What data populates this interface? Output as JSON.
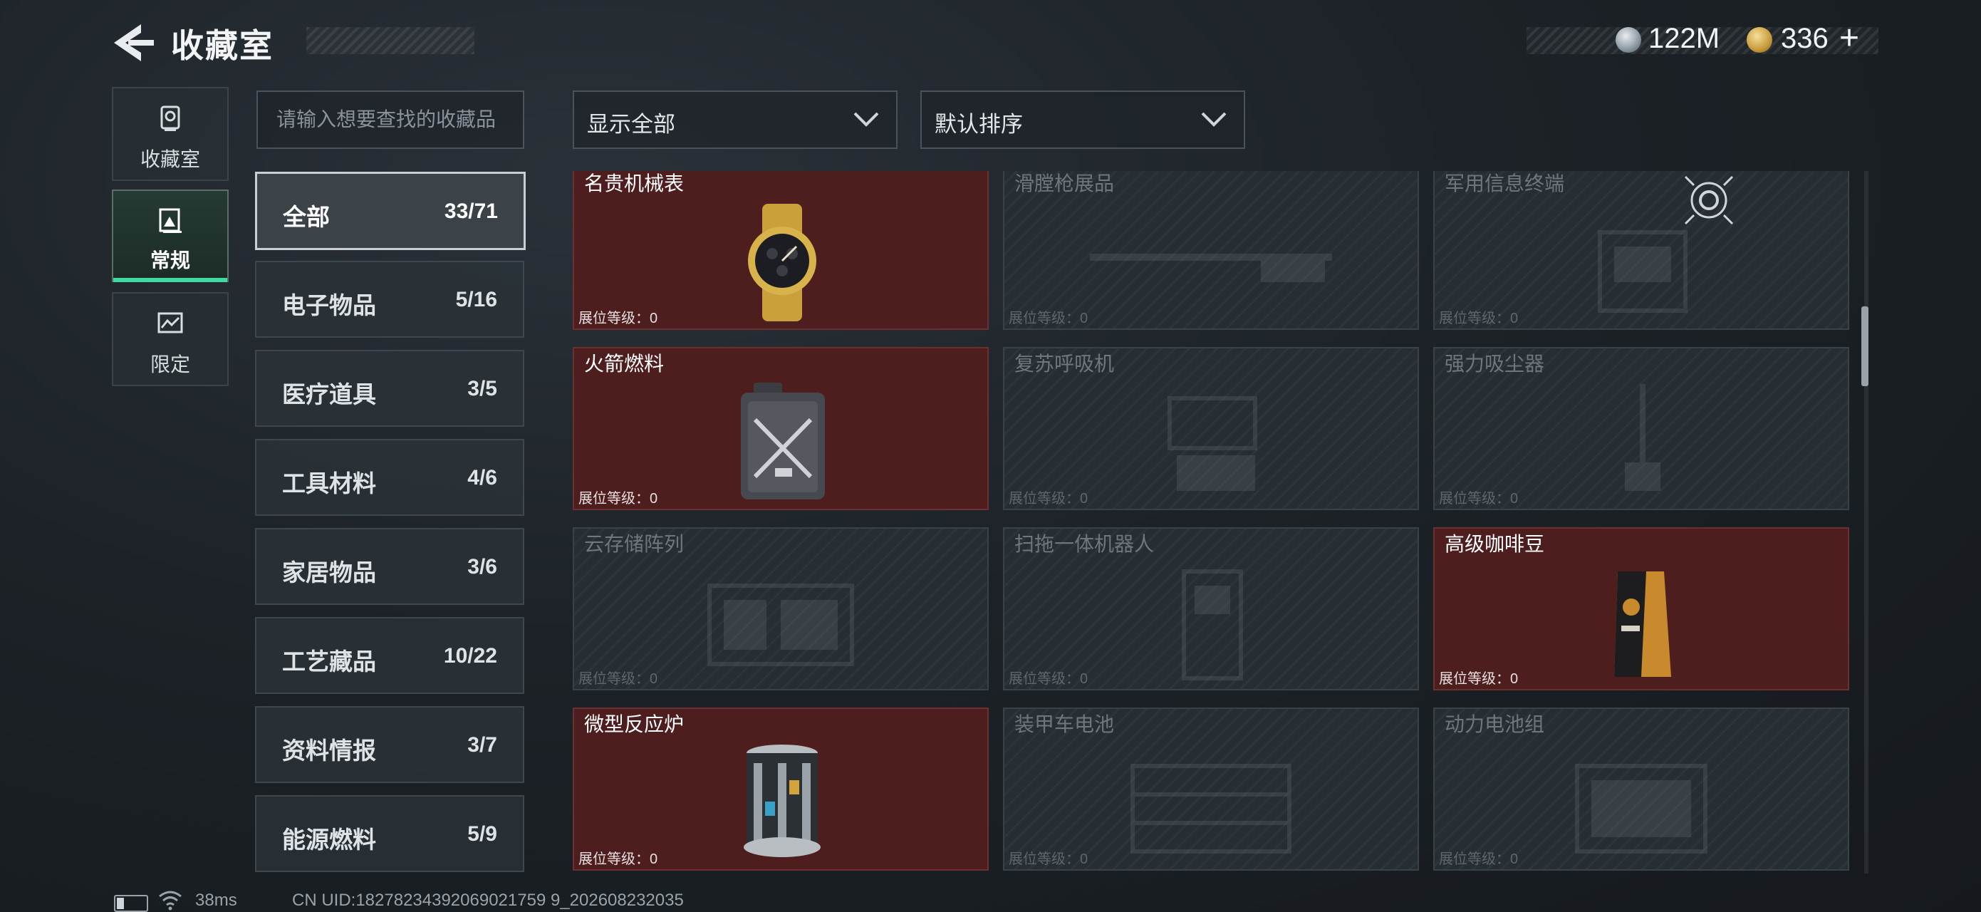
{
  "header": {
    "title": "收藏室",
    "currency1": "122M",
    "currency2": "336",
    "plus": "+"
  },
  "nav": [
    {
      "label": "收藏室",
      "icon": "trophy-icon"
    },
    {
      "label": "常规",
      "icon": "gallery-icon",
      "active": true
    },
    {
      "label": "限定",
      "icon": "limited-icon"
    }
  ],
  "search": {
    "placeholder": "请输入想要查找的收藏品"
  },
  "filter": {
    "value": "显示全部"
  },
  "sort": {
    "value": "默认排序"
  },
  "categories": [
    {
      "name": "全部",
      "count": "33/71"
    },
    {
      "name": "电子物品",
      "count": "5/16"
    },
    {
      "name": "医疗道具",
      "count": "3/5"
    },
    {
      "name": "工具材料",
      "count": "4/6"
    },
    {
      "name": "家居物品",
      "count": "3/6"
    },
    {
      "name": "工艺藏品",
      "count": "10/22"
    },
    {
      "name": "资料情报",
      "count": "3/7"
    },
    {
      "name": "能源燃料",
      "count": "5/9"
    }
  ],
  "items": [
    {
      "name": "名贵机械表",
      "level": "展位等级：0",
      "owned": true,
      "icon": "watch-icon"
    },
    {
      "name": "滑膛枪展品",
      "level": "展位等级：0",
      "owned": false,
      "icon": "musket-icon"
    },
    {
      "name": "军用信息终端",
      "level": "展位等级：0",
      "owned": false,
      "icon": "terminal-icon"
    },
    {
      "name": "火箭燃料",
      "level": "展位等级：0",
      "owned": true,
      "icon": "fuel-can-icon"
    },
    {
      "name": "复苏呼吸机",
      "level": "展位等级：0",
      "owned": false,
      "icon": "ventilator-icon"
    },
    {
      "name": "强力吸尘器",
      "level": "展位等级：0",
      "owned": false,
      "icon": "vacuum-icon"
    },
    {
      "name": "云存储阵列",
      "level": "展位等级：0",
      "owned": false,
      "icon": "storage-array-icon"
    },
    {
      "name": "扫拖一体机器人",
      "level": "展位等级：0",
      "owned": false,
      "icon": "robot-vacuum-icon"
    },
    {
      "name": "高级咖啡豆",
      "level": "展位等级：0",
      "owned": true,
      "icon": "coffee-bag-icon"
    },
    {
      "name": "微型反应炉",
      "level": "展位等级：0",
      "owned": true,
      "icon": "reactor-icon"
    },
    {
      "name": "装甲车电池",
      "level": "展位等级：0",
      "owned": false,
      "icon": "battery-icon"
    },
    {
      "name": "动力电池组",
      "level": "展位等级：0",
      "owned": false,
      "icon": "battery-pack-icon"
    }
  ],
  "footer": {
    "ping": "38ms",
    "uid": "CN UID:18278234392069021759 9_202608232035"
  },
  "colors": {
    "accent": "#3fd9a1",
    "owned_card": "#4e1e1f",
    "locked_card": "#262d33"
  }
}
